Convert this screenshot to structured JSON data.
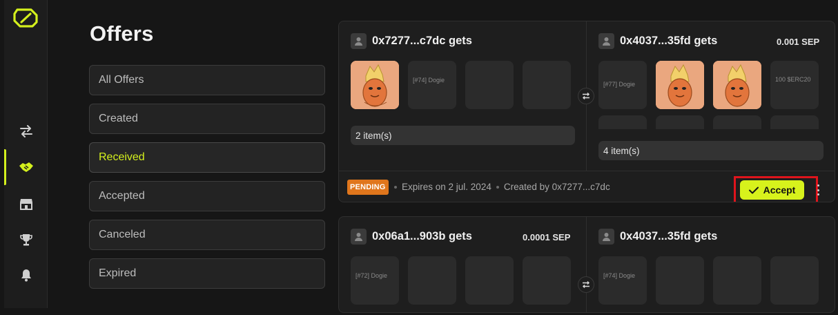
{
  "app": {
    "title": "Offers"
  },
  "colors": {
    "accent": "#d4f01d",
    "pending": "#e0761c",
    "highlight": "#e0141c"
  },
  "sidebar": {
    "logo": "logo-icon",
    "items": [
      {
        "icon": "swap-arrows-icon",
        "active": false
      },
      {
        "icon": "handshake-icon",
        "active": true
      },
      {
        "icon": "storefront-icon",
        "active": false
      },
      {
        "icon": "trophy-icon",
        "active": false
      },
      {
        "icon": "bell-icon",
        "active": false
      }
    ]
  },
  "filters": [
    {
      "label": "All Offers",
      "active": false
    },
    {
      "label": "Created",
      "active": false
    },
    {
      "label": "Received",
      "active": true
    },
    {
      "label": "Accepted",
      "active": false
    },
    {
      "label": "Canceled",
      "active": false
    },
    {
      "label": "Expired",
      "active": false
    }
  ],
  "offers": [
    {
      "left": {
        "name": "0x7277...c7dc gets",
        "amount": "",
        "items": [
          {
            "type": "nft",
            "label": ""
          },
          {
            "type": "text",
            "label": "[#74] Dogie"
          },
          {
            "type": "empty",
            "label": ""
          },
          {
            "type": "empty",
            "label": ""
          }
        ],
        "count": "2 item(s)"
      },
      "right": {
        "name": "0x4037...35fd gets",
        "amount": "0.001 SEP",
        "items": [
          {
            "type": "text",
            "label": "[#77] Dogie"
          },
          {
            "type": "nft",
            "label": ""
          },
          {
            "type": "nft",
            "label": ""
          },
          {
            "type": "text",
            "label": "100 $ERC20"
          }
        ],
        "count": "4 item(s)"
      },
      "status": "PENDING",
      "expires": "Expires on 2 jul. 2024",
      "created_by": "Created by 0x7277...c7dc",
      "accept_label": "Accept"
    },
    {
      "left": {
        "name": "0x06a1...903b gets",
        "amount": "0.0001 SEP",
        "items": [
          {
            "type": "text",
            "label": "[#72] Dogie"
          },
          {
            "type": "empty",
            "label": ""
          },
          {
            "type": "empty",
            "label": ""
          },
          {
            "type": "empty",
            "label": ""
          }
        ]
      },
      "right": {
        "name": "0x4037...35fd gets",
        "amount": "",
        "items": [
          {
            "type": "text",
            "label": "[#74] Dogie"
          },
          {
            "type": "empty",
            "label": ""
          },
          {
            "type": "empty",
            "label": ""
          },
          {
            "type": "empty",
            "label": ""
          }
        ]
      }
    }
  ]
}
